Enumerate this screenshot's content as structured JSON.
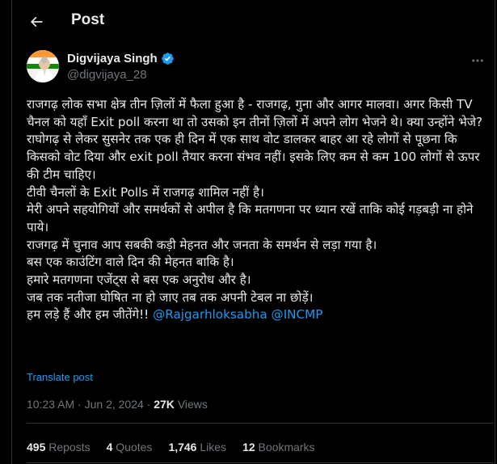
{
  "header": {
    "title": "Post"
  },
  "author": {
    "name": "Digvijaya Singh",
    "handle": "@digvijaya_28"
  },
  "post": {
    "lines": [
      "राजगढ़ लोक सभा क्षेत्र तीन ज़िलों में फैला हुआ है - राजगढ़, गुना और आगर मालवा। अगर किसी TV चैनल को यहाँ Exit poll करना था  तो उसको इन तीनों ज़िलों में अपने लोग भेजने थे। क्या उन्होंने भेजे?",
      "राघोगढ़ से लेकर सुसनेर तक एक ही दिन में एक साथ वोट डालकर बाहर आ रहे लोगों से पूछना कि किसको वोट दिया और exit poll तैयार करना संभव नहीं। इसके लिए कम से कम 100 लोगों से ऊपर की टीम चाहिए।",
      "टीवी चैनलों के Exit Polls में राजगढ़ शामिल नहीं है।",
      "मेरी अपने सहयोगियों और समर्थकों से अपील है कि मतगणना पर ध्यान रखें ताकि कोई गड़बड़ी ना होने पाये।",
      "राजगढ़ में चुनाव आप सबकी कड़ी मेहनत और जनता के समर्थन से लड़ा गया है।",
      "बस एक काउंटिंग वाले दिन की मेहनत बाकि है।",
      "हमारे मतगणना एजेंट्स से बस एक अनुरोध और है।",
      "जब तक नतीजा घोषित ना हो जाए तब तक अपनी टेबल ना छोड़ें।"
    ],
    "last_line_text": "हम लड़े हैं और हम जीतेंगे!! ",
    "mention1": "@Rajgarhloksabha",
    "mention2": "@INCMP"
  },
  "translate_label": "Translate post",
  "meta": {
    "time": "10:23 AM",
    "sep": "·",
    "date": "Jun 2, 2024",
    "views_count": "27K",
    "views_label": "Views"
  },
  "stats": {
    "reposts_count": "495",
    "reposts_label": "Reposts",
    "quotes_count": "4",
    "quotes_label": "Quotes",
    "likes_count": "1,746",
    "likes_label": "Likes",
    "bookmarks_count": "12",
    "bookmarks_label": "Bookmarks"
  },
  "icons": {
    "back": "arrow-left-icon",
    "verified": "verified-badge-icon",
    "more": "more-horizontal-icon"
  },
  "colors": {
    "accent": "#1d9bf0",
    "text": "#e7e9ea",
    "muted": "#71767b",
    "background": "#000000"
  }
}
